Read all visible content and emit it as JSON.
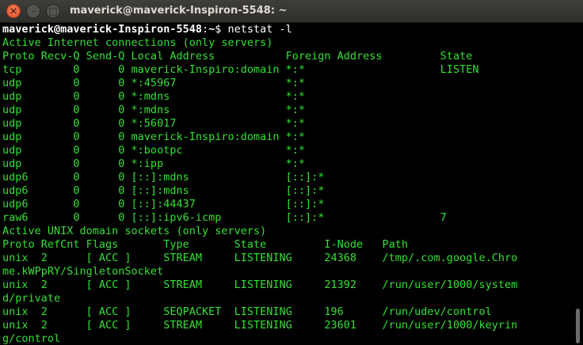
{
  "window": {
    "title": "maverick@maverick-Inspiron-5548: ~",
    "buttons": {
      "close": "✕",
      "minimize": "–",
      "maximize": "□"
    }
  },
  "prompt": {
    "user_host": "maverick@maverick-Inspiron-5548",
    "separator": ":",
    "path": "~",
    "symbol": "$ ",
    "command": "netstat -l"
  },
  "output": [
    "Active Internet connections (only servers)",
    "Proto Recv-Q Send-Q Local Address           Foreign Address         State",
    "tcp        0      0 maverick-Inspiro:domain *:*                     LISTEN",
    "udp        0      0 *:45967                 *:*",
    "udp        0      0 *:mdns                  *:*",
    "udp        0      0 *:mdns                  *:*",
    "udp        0      0 *:56017                 *:*",
    "udp        0      0 maverick-Inspiro:domain *:*",
    "udp        0      0 *:bootpc                *:*",
    "udp        0      0 *:ipp                   *:*",
    "udp6       0      0 [::]:mdns               [::]:*",
    "udp6       0      0 [::]:mdns               [::]:*",
    "udp6       0      0 [::]:44437              [::]:*",
    "raw6       0      0 [::]:ipv6-icmp          [::]:*                  7",
    "Active UNIX domain sockets (only servers)",
    "Proto RefCnt Flags       Type       State         I-Node   Path",
    "unix  2      [ ACC ]     STREAM     LISTENING     24368    /tmp/.com.google.Chro",
    "me.kWPpRY/SingletonSocket",
    "unix  2      [ ACC ]     STREAM     LISTENING     21392    /run/user/1000/system",
    "d/private",
    "unix  2      [ ACC ]     SEQPACKET  LISTENING     196      /run/udev/control",
    "unix  2      [ ACC ]     STREAM     LISTENING     23601    /run/user/1000/keyrin",
    "g/control"
  ],
  "colors": {
    "background": "#000000",
    "output_text": "#33e033",
    "prompt_text": "#ffffff",
    "titlebar": "#3c3b37",
    "close_button": "#e95420"
  },
  "icons": [
    "close-icon",
    "minimize-icon",
    "maximize-icon"
  ]
}
